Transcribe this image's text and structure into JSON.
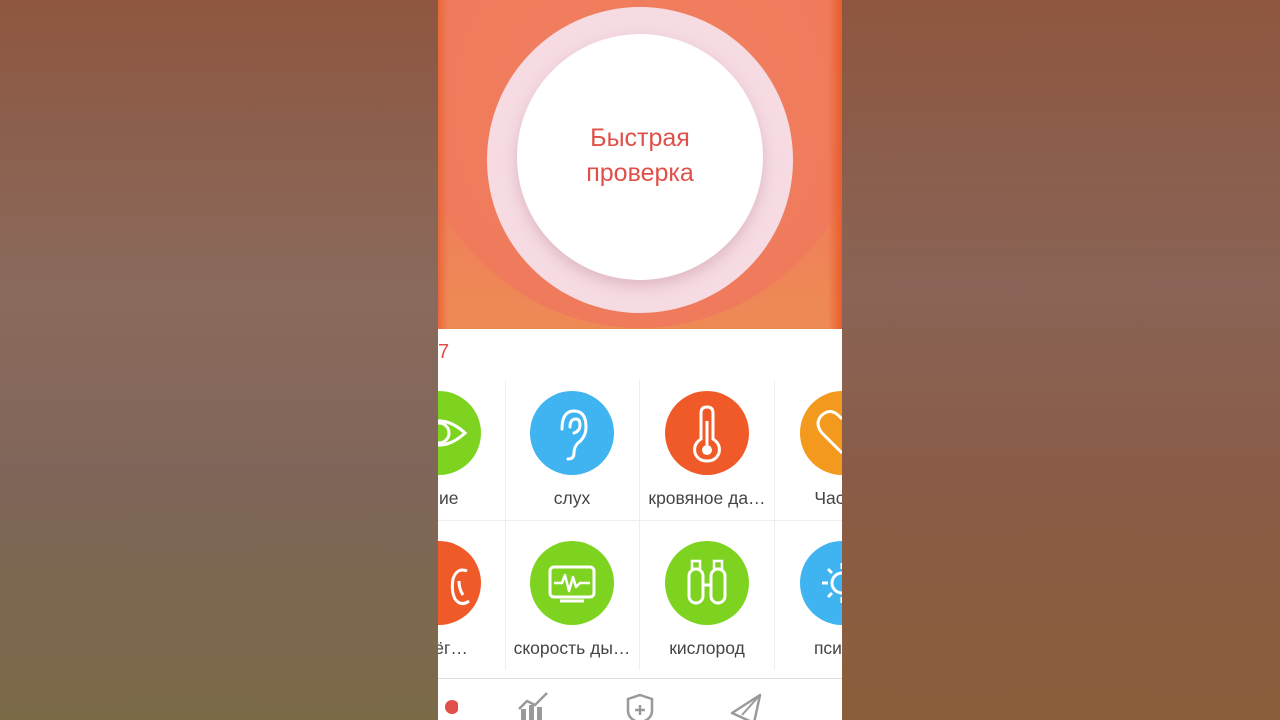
{
  "hero": {
    "quick_check_label": "Быстрая\nпроверка",
    "colors": {
      "hero": "#ef7a5b",
      "ring": "#f6dbe3",
      "accent": "#e0504a"
    }
  },
  "section": {
    "counter_text": "7"
  },
  "tiles": [
    {
      "label": "ение",
      "icon": "eye-icon",
      "color": "#7ed321"
    },
    {
      "label": "слух",
      "icon": "ear-icon",
      "color": "#3fb4f0"
    },
    {
      "label": "кровяное да…",
      "icon": "thermometer-icon",
      "color": "#f05a28"
    },
    {
      "label": "Частот",
      "icon": "heart-rate-icon",
      "color": "#f39a1e"
    },
    {
      "label": "ь лёг…",
      "icon": "lungs-icon",
      "color": "#f05a28"
    },
    {
      "label": "скорость ды…",
      "icon": "breath-monitor-icon",
      "color": "#7ed321"
    },
    {
      "label": "кислород",
      "icon": "oxygen-tanks-icon",
      "color": "#7ed321"
    },
    {
      "label": "психол",
      "icon": "psychology-icon",
      "color": "#3fb4f0"
    }
  ],
  "bottom_nav": [
    {
      "icon": "home-icon"
    },
    {
      "icon": "statistics-icon"
    },
    {
      "icon": "health-shield-icon"
    },
    {
      "icon": "send-icon"
    }
  ]
}
